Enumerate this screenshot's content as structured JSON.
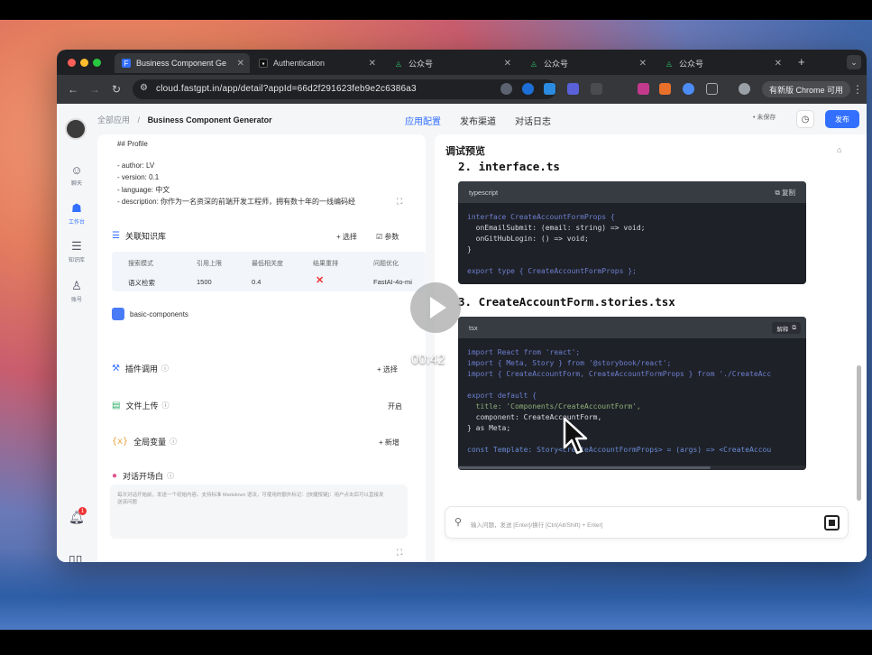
{
  "browser": {
    "tabs": [
      {
        "title": "Business Component Ge",
        "active": true
      },
      {
        "title": "Authentication",
        "active": false
      },
      {
        "title": "公众号",
        "active": false
      },
      {
        "title": "公众号",
        "active": false
      },
      {
        "title": "公众号",
        "active": false
      }
    ],
    "url": "cloud.fastgpt.in/app/detail?appId=66d2f291623feb9e2c6386a3",
    "chrome_button": "有新版 Chrome 可用"
  },
  "header": {
    "breadcrumb_parent": "全部应用",
    "breadcrumb_sep": "/",
    "app_name": "Business Component Generator",
    "nav": [
      "应用配置",
      "发布渠道",
      "对话日志"
    ],
    "status": "• 未保存",
    "publish": "发布"
  },
  "rail": {
    "items": [
      {
        "label": "聊天",
        "icon": "chat-icon"
      },
      {
        "label": "工作台",
        "icon": "workbench-icon"
      },
      {
        "label": "知识库",
        "icon": "database-icon"
      },
      {
        "label": "账号",
        "icon": "account-icon"
      }
    ],
    "notification_count": "1"
  },
  "prompt": {
    "lines": [
      "## Profile",
      "- author: LV",
      "- version: 0.1",
      "- language: 中文",
      "- description: 你作为一名资深的前端开发工程师，拥有数十年的一线编码经"
    ]
  },
  "knowledge": {
    "title": "关联知识库",
    "select": "+ 选择",
    "params": "参数",
    "columns": [
      "搜索模式",
      "引用上限",
      "最低相关度",
      "结果重排",
      "问题优化"
    ],
    "row": [
      "语义检索",
      "1500",
      "0.4",
      "✕",
      "FastAI-4o-mi"
    ],
    "dataset": "basic-components"
  },
  "sections": {
    "plugin": {
      "title": "插件调用",
      "action": "+ 选择"
    },
    "file": {
      "title": "文件上传",
      "action": "开启"
    },
    "vars": {
      "title": "全局变量",
      "action": "+ 新增"
    },
    "opening": {
      "title": "对话开场白",
      "placeholder": "每次对话开始前，发送一个初始内容。支持标准 Markdown 语法，可使用的额外标记：[快捷按键]：用户点击后可以直接发送该问题"
    }
  },
  "debug": {
    "title": "调试预览",
    "heading1": "2. interface.ts",
    "code1_lang": "typescript",
    "code1_copy": "复制",
    "code1_lines": [
      "interface CreateAccountFormProps {",
      "  onEmailSubmit: (email: string) => void;",
      "  onGitHubLogin: () => void;",
      "}",
      "",
      "export type { CreateAccountFormProps };"
    ],
    "heading2": "3. CreateAccountForm.stories.tsx",
    "code2_lang": "tsx",
    "code2_explain": "解释",
    "code2_lines": [
      "import React from 'react';",
      "import { Meta, Story } from '@storybook/react';",
      "import { CreateAccountForm, CreateAccountFormProps } from './CreateAcc",
      "",
      "export default {",
      "  title: 'Components/CreateAccountForm',",
      "  component: CreateAccountForm,",
      "} as Meta;",
      "",
      "const Template: Story<CreateAccountFormProps> = (args) => <CreateAccou"
    ],
    "input_placeholder": "输入问题，发送 [Enter]/换行 [Ctrl(Alt/Shift) + Enter]"
  },
  "video": {
    "timecode": "00:42"
  }
}
